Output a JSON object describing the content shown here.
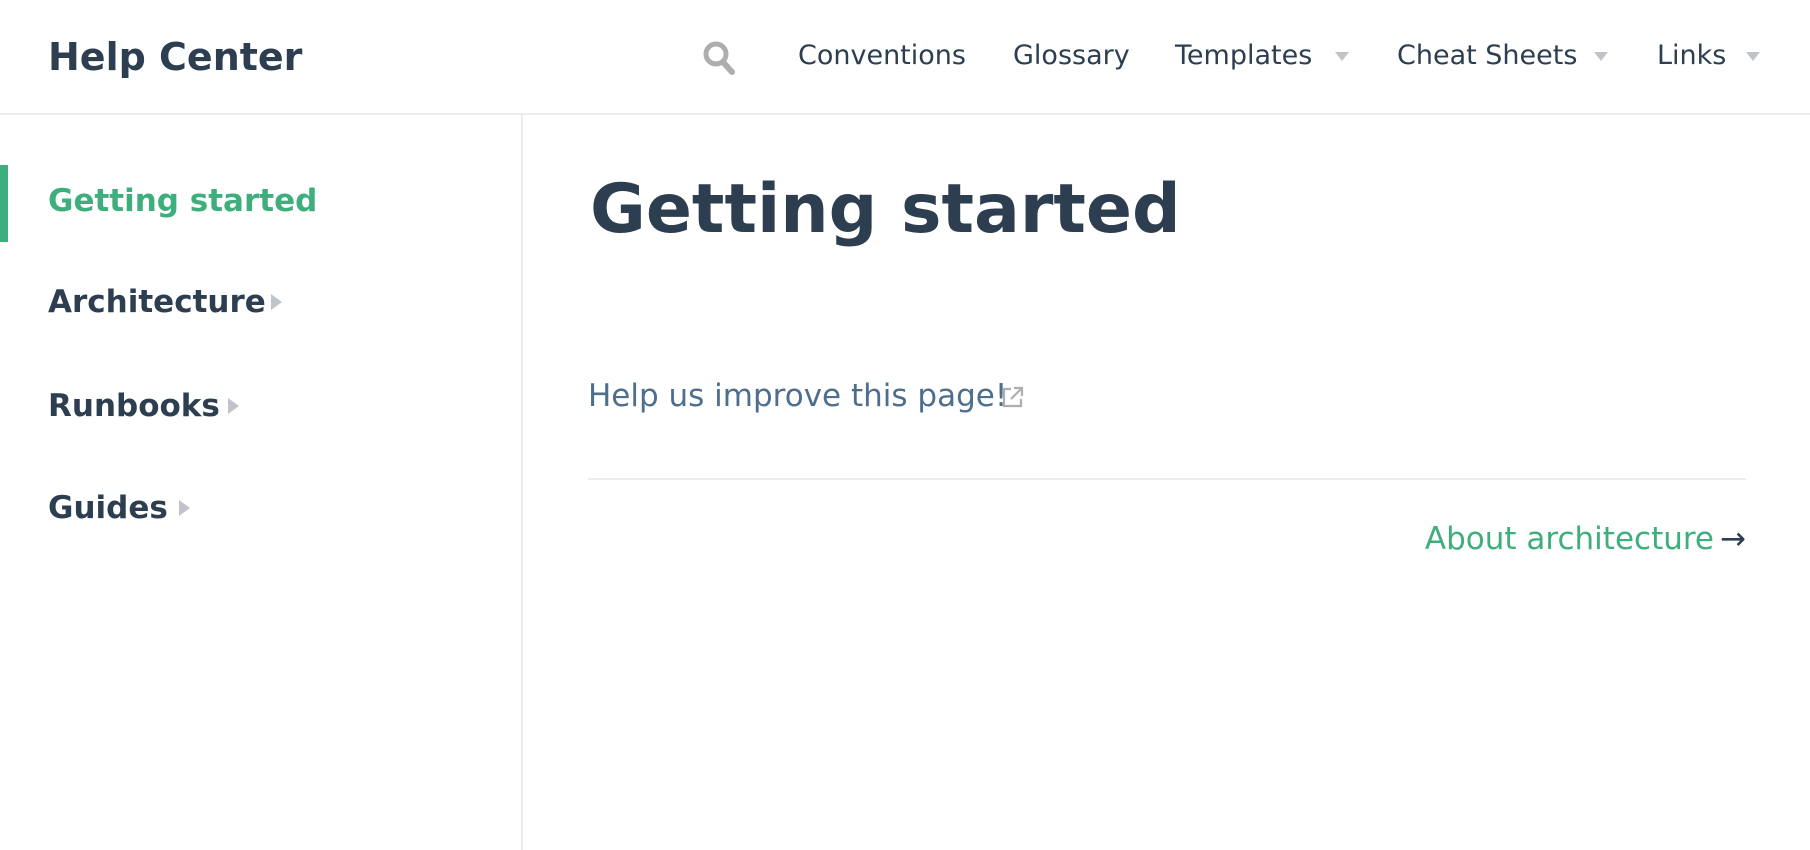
{
  "header": {
    "site_title": "Help Center",
    "search_icon": "search-icon",
    "nav": [
      {
        "label": "Conventions",
        "dropdown": false
      },
      {
        "label": "Glossary",
        "dropdown": false
      },
      {
        "label": "Templates",
        "dropdown": true
      },
      {
        "label": "Cheat Sheets",
        "dropdown": true
      },
      {
        "label": "Links",
        "dropdown": true
      }
    ]
  },
  "sidebar": {
    "items": [
      {
        "label": "Getting started",
        "active": true,
        "expandable": false
      },
      {
        "label": "Architecture",
        "active": false,
        "expandable": true
      },
      {
        "label": "Runbooks",
        "active": false,
        "expandable": true
      },
      {
        "label": "Guides",
        "active": false,
        "expandable": true
      }
    ]
  },
  "main": {
    "title": "Getting started",
    "edit_link": "Help us improve this page!",
    "next_link": {
      "label": "About architecture",
      "arrow": "→"
    }
  },
  "colors": {
    "accent": "#3eaf7c",
    "text": "#2c3e50",
    "muted_link": "#4e6e8e",
    "border": "#eaecef",
    "icon_gray": "#c0c4c8"
  }
}
